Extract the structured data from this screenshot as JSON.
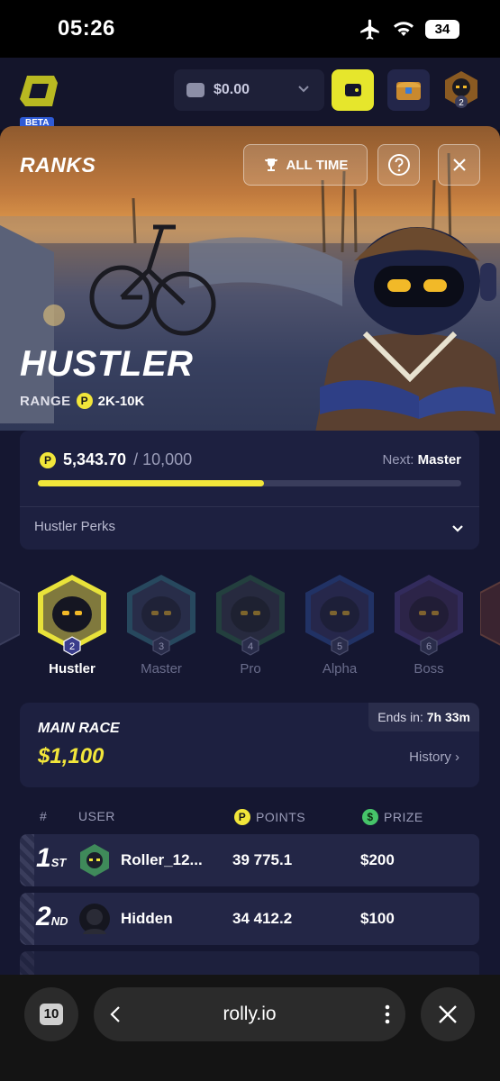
{
  "status_bar": {
    "time": "05:26",
    "battery": "34",
    "icons": [
      "airplane-icon",
      "wifi-icon",
      "battery-icon"
    ]
  },
  "app_header": {
    "logo_icon": "rolly-logo-icon",
    "beta_label": "BETA",
    "wallet_balance": "$0.00",
    "wallet_icon": "wallet-icon",
    "level_badge": "2"
  },
  "ranks": {
    "title": "RANKS",
    "filter_label": "ALL TIME",
    "rank_name": "HUSTLER",
    "range_label": "RANGE",
    "range_value": "2K-10K",
    "progress": {
      "current": "5,343.70",
      "max": "/ 10,000",
      "fraction": 0.5344,
      "next_label": "Next:",
      "next_rank": "Master"
    },
    "perks_label": "Hustler Perks",
    "tiers": [
      {
        "level": "2",
        "name": "Hustler",
        "active": true,
        "color": "#e8e23a"
      },
      {
        "level": "3",
        "name": "Master",
        "active": false,
        "color": "#4aa3b5"
      },
      {
        "level": "4",
        "name": "Pro",
        "active": false,
        "color": "#3f8a5a"
      },
      {
        "level": "5",
        "name": "Alpha",
        "active": false,
        "color": "#3a63c8"
      },
      {
        "level": "6",
        "name": "Boss",
        "active": false,
        "color": "#6a4fb0"
      }
    ]
  },
  "race": {
    "title": "MAIN RACE",
    "amount": "$1,100",
    "ends_label": "Ends in:",
    "ends_value": "7h 33m",
    "history_label": "History"
  },
  "leaderboard": {
    "headers": {
      "rank": "#",
      "user": "USER",
      "points": "POINTS",
      "prize": "PRIZE"
    },
    "rows": [
      {
        "rank": "1",
        "suffix": "ST",
        "user": "Roller_12...",
        "points": "39 775.1",
        "prize": "$200"
      },
      {
        "rank": "2",
        "suffix": "ND",
        "user": "Hidden",
        "points": "34 412.2",
        "prize": "$100"
      }
    ]
  },
  "browser": {
    "tab_count": "10",
    "url": "rolly.io"
  },
  "colors": {
    "accent_yellow": "#f2e63a",
    "panel_bg": "#151731",
    "card_bg": "#1d2040"
  }
}
